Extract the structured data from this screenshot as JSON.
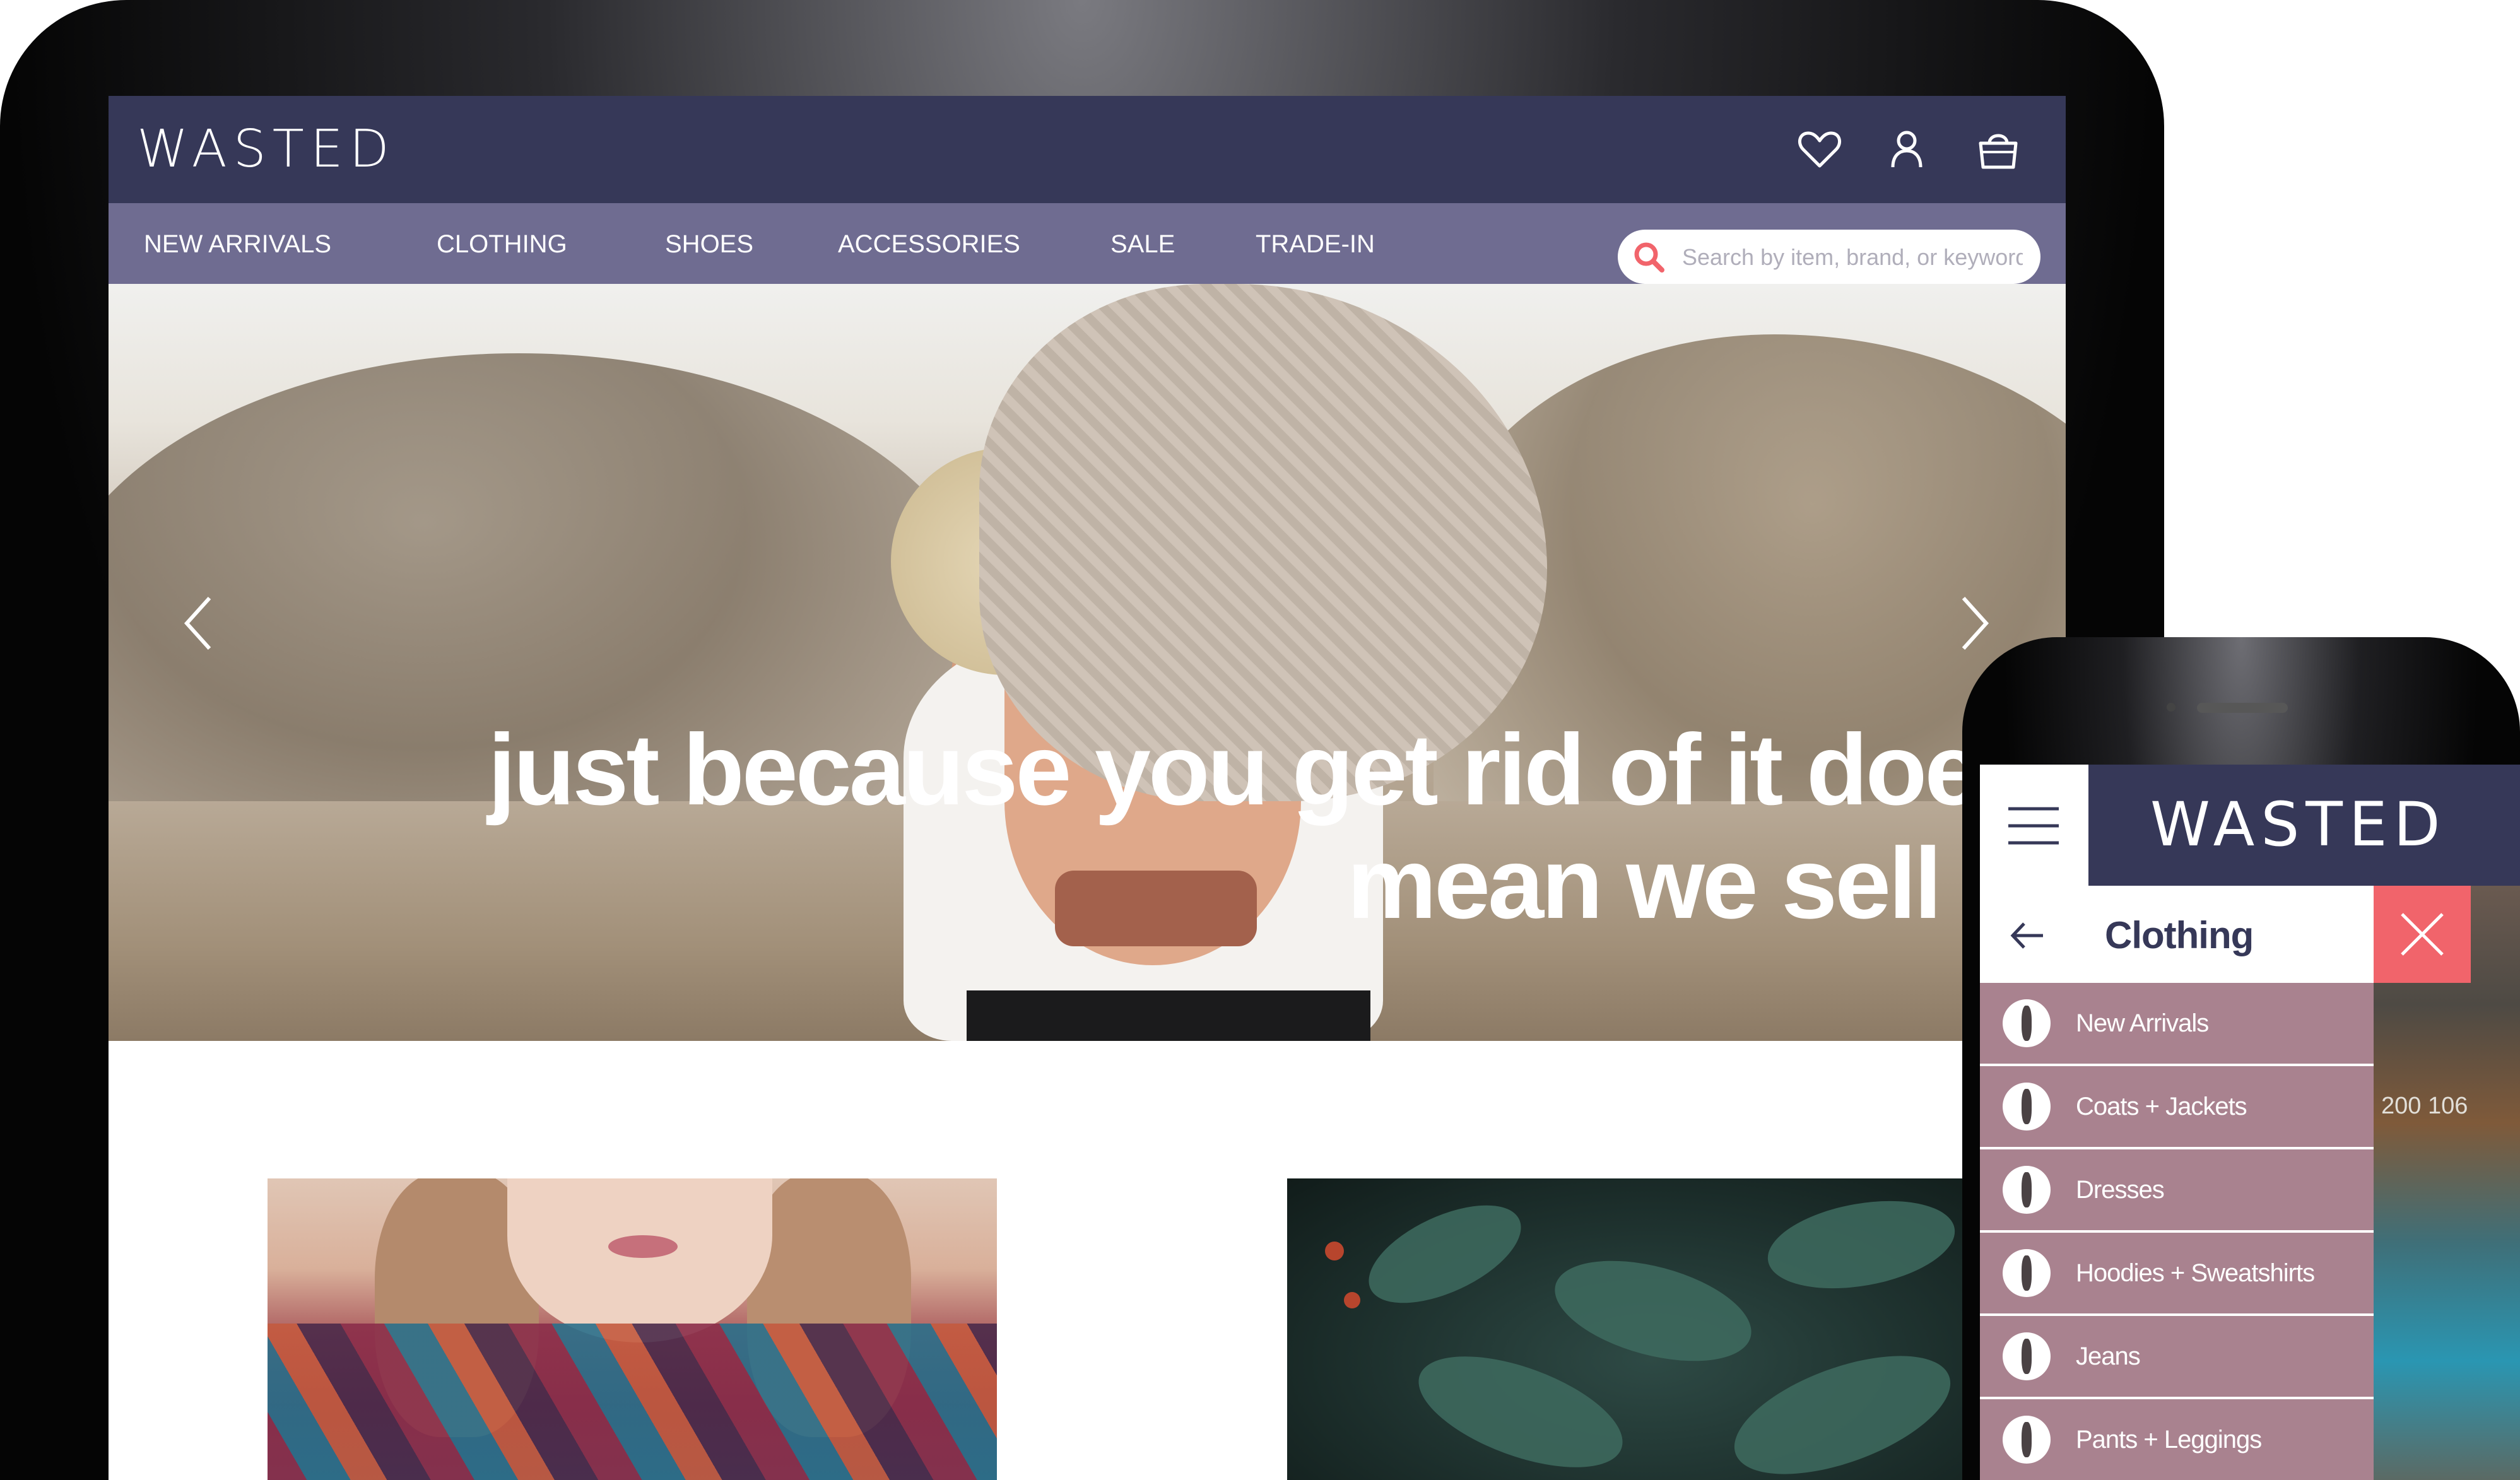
{
  "desktop": {
    "logo": "WASTED",
    "header_icons": [
      "heart-icon",
      "user-icon",
      "shopping-bag-icon"
    ],
    "nav": {
      "items": [
        "NEW ARRIVALS",
        "CLOTHING",
        "SHOES",
        "ACCESSORIES",
        "SALE",
        "TRADE-IN"
      ]
    },
    "search": {
      "placeholder": "Search by item, brand, or keyword"
    },
    "hero": {
      "line1": "just because you get rid of it doesn",
      "line2": "mean we sell"
    }
  },
  "mobile": {
    "logo": "WASTED",
    "menu": {
      "title": "Clothing",
      "items": [
        "New Arrivals",
        "Coats + Jackets",
        "Dresses",
        "Hoodies + Sweatshirts",
        "Jeans",
        "Pants + Leggings"
      ]
    },
    "background_text": "200 106"
  },
  "colors": {
    "header": "#363858",
    "nav": "#6f6c91",
    "menu_item": "#a9828f",
    "close": "#f1646b",
    "search_icon": "#f1646b"
  }
}
